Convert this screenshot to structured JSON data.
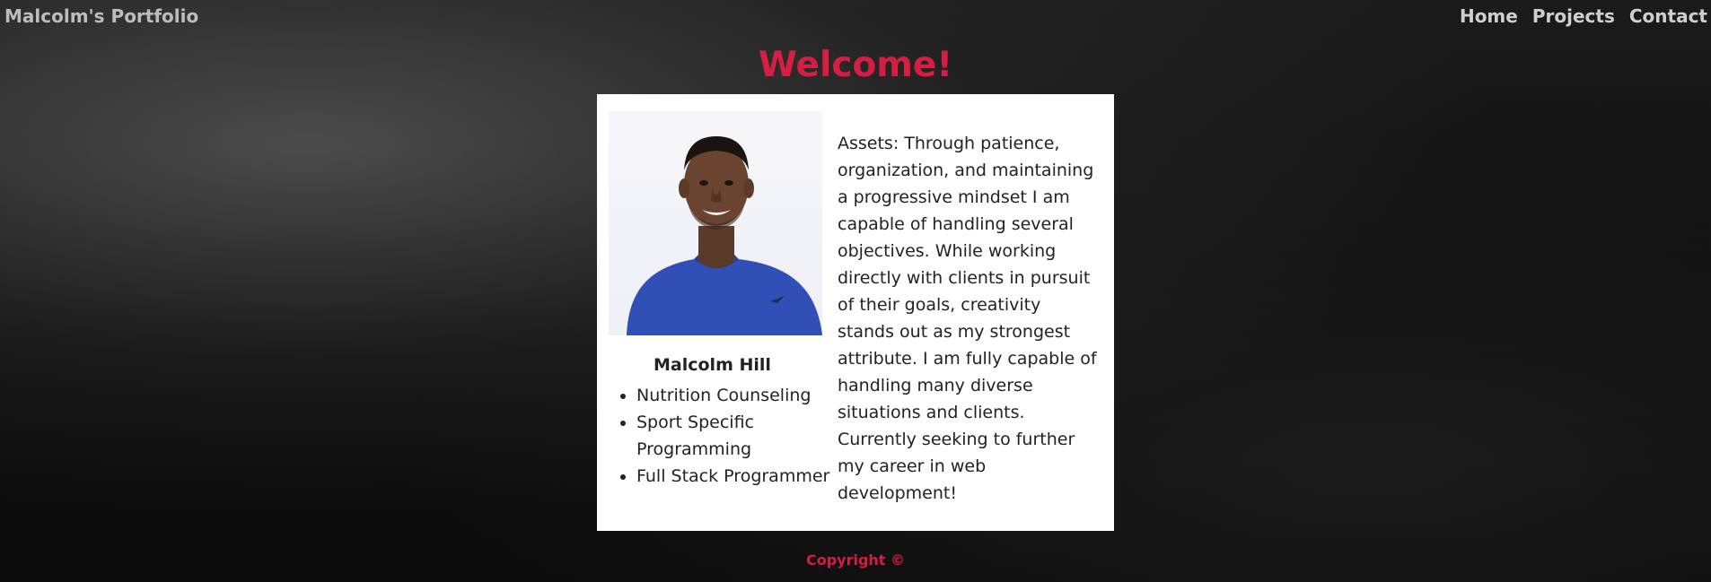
{
  "header": {
    "brand": "Malcolm's Portfolio",
    "nav": [
      {
        "label": "Home"
      },
      {
        "label": "Projects"
      },
      {
        "label": "Contact"
      }
    ]
  },
  "main": {
    "heading": "Welcome!",
    "profile": {
      "photo": "profile-photo",
      "name": "Malcolm Hill",
      "skills": [
        "Nutrition Counseling",
        "Sport Specific Programming",
        "Full Stack Programmer"
      ],
      "bio": "Assets: Through patience, organization, and maintaining a progressive mindset I am capable of handling several objectives. While working directly with clients in pursuit of their goals, creativity stands out as my strongest attribute. I am fully capable of handling many diverse situations and clients. Currently seeking to further my career in web development!"
    }
  },
  "footer": {
    "copyright": "Copyright ©"
  },
  "colors": {
    "accent": "#d51e41",
    "nav_text": "#cfcfcf",
    "card_bg": "#ffffff"
  }
}
